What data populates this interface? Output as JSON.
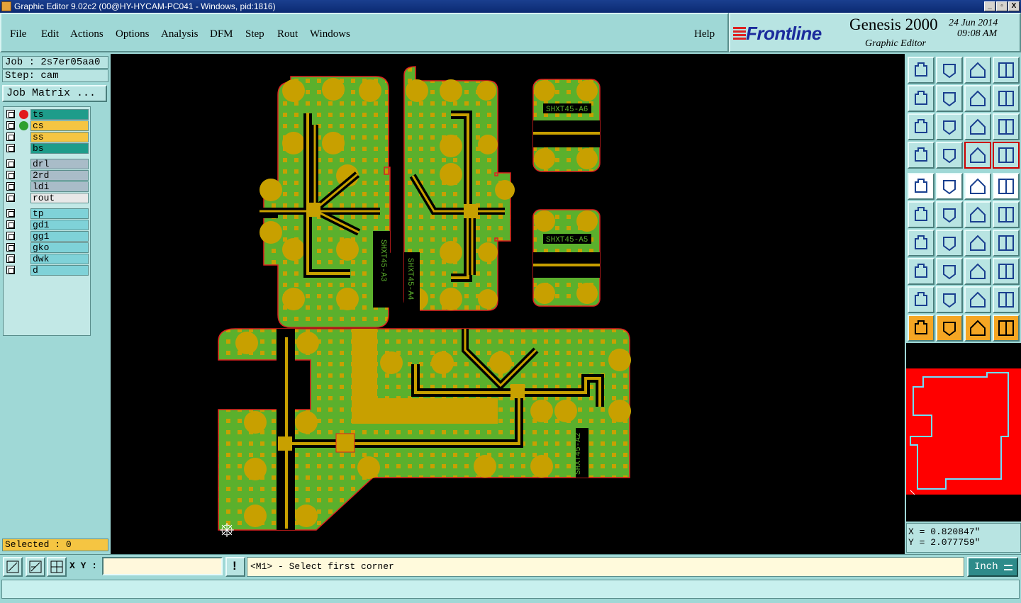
{
  "window": {
    "title": "Graphic Editor 9.02c2 (00@HY-HYCAM-PC041 - Windows, pid:1816)",
    "controls": [
      "_",
      "▫",
      "X"
    ]
  },
  "menu": {
    "items": [
      "File",
      "Edit",
      "Actions",
      "Options",
      "Analysis",
      "DFM",
      "Step",
      "Rout",
      "Windows"
    ],
    "help": "Help"
  },
  "brand": {
    "logo": "Frontline",
    "product": "Genesis 2000",
    "subtitle": "Graphic Editor",
    "date": "24 Jun 2014",
    "time": "09:08 AM"
  },
  "job": {
    "job_label": "Job : 2s7er05aa0",
    "step_label": "Step: cam",
    "matrix_button": "Job Matrix ..."
  },
  "layers": [
    {
      "name": "ts",
      "color": "#1e9c8a",
      "dot": "#e21b1b",
      "group": 1
    },
    {
      "name": "cs",
      "color": "#f5c542",
      "dot": "#2fa02f",
      "group": 1
    },
    {
      "name": "ss",
      "color": "#f5c542",
      "dot": "",
      "group": 1
    },
    {
      "name": "bs",
      "color": "#1e9c8a",
      "dot": "",
      "group": 1
    },
    {
      "name": "drl",
      "color": "#a9bcc8",
      "dot": "",
      "group": 2
    },
    {
      "name": "2rd",
      "color": "#a9bcc8",
      "dot": "",
      "group": 2
    },
    {
      "name": "ldi",
      "color": "#a9bcc8",
      "dot": "",
      "group": 2
    },
    {
      "name": "rout",
      "color": "#e8e8e8",
      "dot": "",
      "group": 2
    },
    {
      "name": "tp",
      "color": "#7fd2d8",
      "dot": "",
      "group": 3
    },
    {
      "name": "gd1",
      "color": "#7fd2d8",
      "dot": "",
      "group": 3
    },
    {
      "name": "gg1",
      "color": "#7fd2d8",
      "dot": "",
      "group": 3
    },
    {
      "name": "gko",
      "color": "#7fd2d8",
      "dot": "",
      "group": 3
    },
    {
      "name": "dwk",
      "color": "#7fd2d8",
      "dot": "",
      "group": 3
    },
    {
      "name": "d",
      "color": "#7fd2d8",
      "dot": "",
      "group": 3
    }
  ],
  "selected_label": "Selected : 0",
  "board_labels": [
    "SHXT45-A3",
    "SHXT45-A4",
    "SHXT45-A6",
    "SHXT45-A5",
    "SHXT45-A2"
  ],
  "coords": {
    "x": "X = 0.820847\"",
    "y": "Y = 2.077759\""
  },
  "bottom": {
    "xy_label": "X Y :",
    "xy_value": "",
    "prompt": "<M1> - Select first corner",
    "units": "Inch",
    "alert_icon": "!"
  },
  "colors": {
    "board": "#5bb02c",
    "copper": "#c8a000",
    "outline": "#e02020",
    "background": "#000000"
  }
}
